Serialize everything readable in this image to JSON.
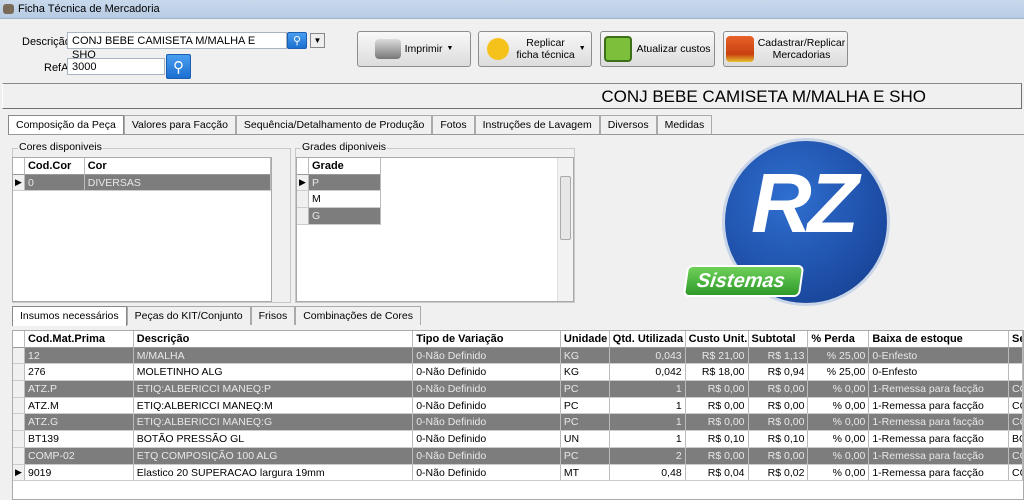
{
  "window": {
    "title": "Ficha Técnica de Mercadoria"
  },
  "search": {
    "descricao_label": "Descrição",
    "descricao_value": "CONJ BEBE CAMISETA M/MALHA E SHO",
    "refa_label": "RefA",
    "refa_value": "3000"
  },
  "toolbar": {
    "imprimir": "Imprimir",
    "replicar_1": "Replicar",
    "replicar_2": "ficha técnica",
    "atualizar": "Atualizar custos",
    "cadastrar_1": "Cadastrar/Replicar",
    "cadastrar_2": "Mercadorias"
  },
  "product_title": "CONJ BEBE CAMISETA M/MALHA E SHO",
  "tabs": [
    "Composição da Peça",
    "Valores para Facção",
    "Sequência/Detalhamento de Produção",
    "Fotos",
    "Instruções de Lavagem",
    "Diversos",
    "Medidas"
  ],
  "cores": {
    "title": "Cores disponiveis",
    "headers": [
      "Cod.Cor",
      "Cor"
    ],
    "rows": [
      [
        "0",
        "DIVERSAS"
      ]
    ]
  },
  "grades": {
    "title": "Grades diponiveis",
    "header": "Grade",
    "rows": [
      "P",
      "M",
      "G"
    ]
  },
  "logo": {
    "text": "RZ",
    "sub": "Sistemas",
    "colors": {
      "circle": "#1e4fa8",
      "badge": "#3fae3a"
    }
  },
  "subtabs": [
    "Insumos necessários",
    "Peças do KIT/Conjunto",
    "Frisos",
    "Combinações de Cores"
  ],
  "insumos": {
    "headers": [
      "Cod.Mat.Prima",
      "Descrição",
      "Tipo de Variação",
      "Unidade",
      "Qtd. Utilizada",
      "Custo Unit.",
      "Subtotal",
      "% Perda",
      "Baixa de estoque",
      "Se"
    ],
    "rows": [
      [
        "12",
        "M/MALHA",
        "0-Não Definido",
        "KG",
        "0,043",
        "R$ 21,00",
        "R$ 1,13",
        "% 25,00",
        "0-Enfesto",
        ""
      ],
      [
        "276",
        "MOLETINHO ALG",
        "0-Não Definido",
        "KG",
        "0,042",
        "R$ 18,00",
        "R$ 0,94",
        "% 25,00",
        "0-Enfesto",
        ""
      ],
      [
        "ATZ.P",
        "ETIQ:ALBERICCI MANEQ:P",
        "0-Não Definido",
        "PC",
        "1",
        "R$ 0,00",
        "R$ 0,00",
        "% 0,00",
        "1-Remessa para facção",
        "CO"
      ],
      [
        "ATZ.M",
        "ETIQ:ALBERICCI MANEQ:M",
        "0-Não Definido",
        "PC",
        "1",
        "R$ 0,00",
        "R$ 0,00",
        "% 0,00",
        "1-Remessa para facção",
        "CO"
      ],
      [
        "ATZ.G",
        "ETIQ:ALBERICCI MANEQ:G",
        "0-Não Definido",
        "PC",
        "1",
        "R$ 0,00",
        "R$ 0,00",
        "% 0,00",
        "1-Remessa para facção",
        "CO"
      ],
      [
        "BT139",
        "BOTÃO PRESSÃO GL",
        "0-Não Definido",
        "UN",
        "1",
        "R$ 0,10",
        "R$ 0,10",
        "% 0,00",
        "1-Remessa para facção",
        "BO"
      ],
      [
        "COMP-02",
        "ETQ COMPOSIÇÃO 100 ALG",
        "0-Não Definido",
        "PC",
        "2",
        "R$ 0,00",
        "R$ 0,00",
        "% 0,00",
        "1-Remessa para facção",
        "CO"
      ],
      [
        "9019",
        "Elastico 20 SUPERACAO largura 19mm",
        "0-Não Definido",
        "MT",
        "0,48",
        "R$ 0,04",
        "R$ 0,02",
        "% 0,00",
        "1-Remessa para facção",
        "CO"
      ]
    ],
    "selected_row": 7
  }
}
